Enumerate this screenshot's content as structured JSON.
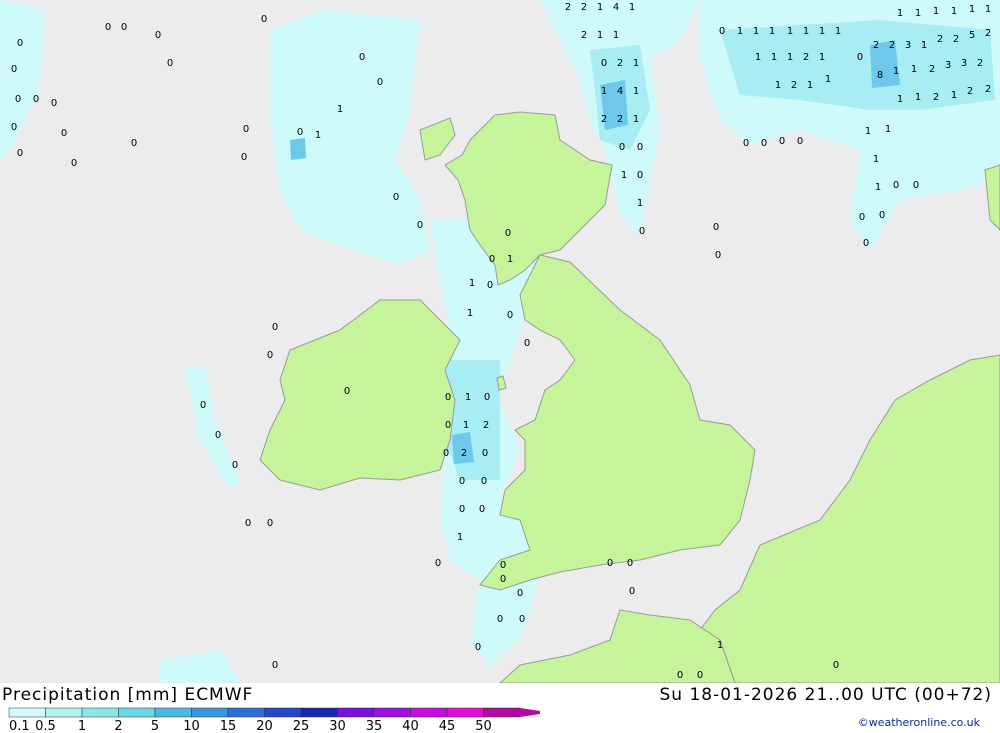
{
  "header": {
    "title": "Precipitation [mm] ECMWF",
    "datetime": "Su 18-01-2026 21..00 UTC (00+72)",
    "credit": "©weatheronline.co.uk"
  },
  "legend": {
    "labels": [
      "0.1",
      "0.5",
      "1",
      "2",
      "5",
      "10",
      "15",
      "20",
      "25",
      "30",
      "35",
      "40",
      "45",
      "50"
    ],
    "colors": [
      "#d4fafa",
      "#b0f2f2",
      "#8ce6e6",
      "#6ad6e6",
      "#4ab8e0",
      "#3a96dc",
      "#2e6ed8",
      "#2446c8",
      "#1a28b0",
      "#7a10e0",
      "#a010e0",
      "#c80ce0",
      "#e010d0",
      "#b00aa0"
    ]
  },
  "map": {
    "colors": {
      "sea": "#ececec",
      "land": "#c6f49a",
      "coast": "#9a9a9a",
      "precip_light": "#cffafa",
      "precip_mid": "#a8ecf4",
      "precip_heavy": "#6ec8ec"
    },
    "values": [
      "0",
      "1",
      "2",
      "3",
      "4",
      "5",
      "8"
    ]
  }
}
